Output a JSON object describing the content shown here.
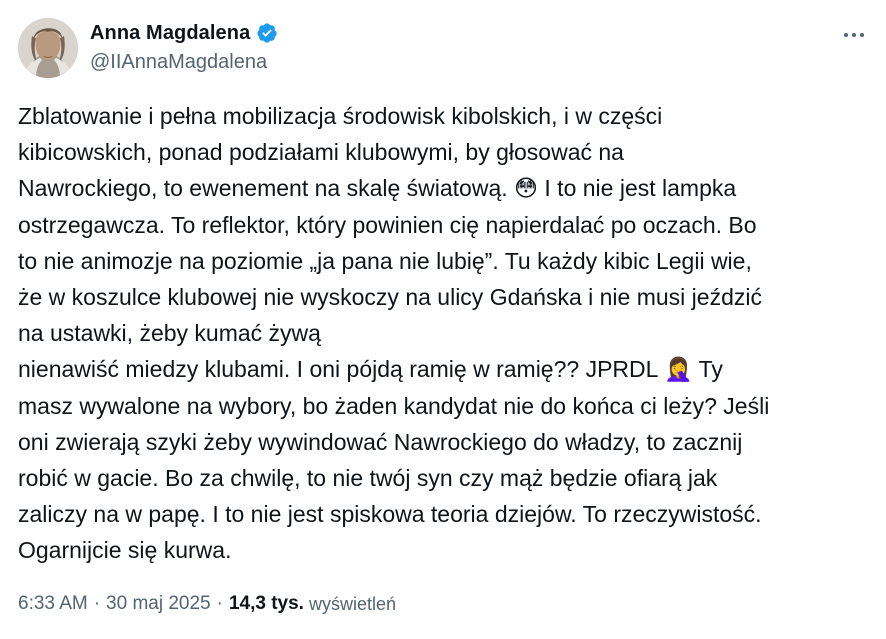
{
  "author": {
    "display_name": "Anna Magdalena",
    "handle": "@IIAnnaMagdalena",
    "verified": true,
    "verified_color": "#1d9bf0",
    "avatar_icon": "profile-photo"
  },
  "menu": {
    "icon": "more-horizontal-icon"
  },
  "tweet": {
    "lines": [
      "Zblatowanie i pełna mobilizacja środowisk kibolskich, i w części",
      "kibicowskich, ponad podziałami klubowymi, by głosować na",
      "Nawrockiego, to ewenement na skalę światową. 😳 I to nie jest lampka",
      "ostrzegawcza. To reflektor, który powinien cię napierdalać po oczach. Bo",
      "to nie animozje na poziomie „ja pana nie lubię”. Tu każdy kibic Legii wie,",
      "że w koszulce klubowej nie wyskoczy na ulicy Gdańska i nie musi jeździć",
      "na ustawki, żeby kumać żywą",
      "nienawiść miedzy klubami. I oni pójdą ramię w ramię?? JPRDL 🤦‍♀️ Ty",
      "masz wywalone na wybory, bo żaden kandydat nie do końca ci leży? Jeśli",
      "oni zwierają szyki żeby wywindować Nawrockiego do władzy, to zacznij",
      "robić w gacie. Bo za chwilę, to nie twój syn czy mąż będzie ofiarą jak",
      "zaliczy na w papę. I to nie jest spiskowa teoria dziejów. To rzeczywistość.",
      "Ogarnijcie się kurwa."
    ]
  },
  "meta": {
    "time": "6:33 AM",
    "date": "30 maj 2025",
    "separator": "·",
    "views_count": "14,3 tys.",
    "views_label": "wyświetleń"
  }
}
